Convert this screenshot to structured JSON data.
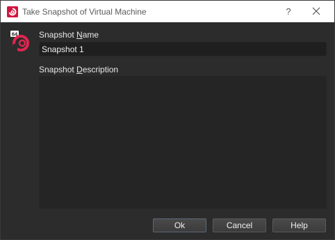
{
  "window": {
    "title": "Take Snapshot of Virtual Machine",
    "help_glyph": "?",
    "app_icon_badge": "64"
  },
  "form": {
    "name_label_prefix": "Snapshot ",
    "name_label_accel": "N",
    "name_label_suffix": "ame",
    "name_value": "Snapshot 1",
    "desc_label_prefix": "Snapshot ",
    "desc_label_accel": "D",
    "desc_label_suffix": "escription",
    "desc_value": ""
  },
  "buttons": {
    "ok": "Ok",
    "cancel": "Cancel",
    "help": "Help"
  },
  "icons": {
    "title_icon": "virtualbox-icon",
    "close_icon": "close-icon",
    "app_icon": "vm-os-icon"
  },
  "colors": {
    "accent": "#e0264f",
    "background": "#2c2c2c",
    "titlebar": "#ffffff"
  }
}
